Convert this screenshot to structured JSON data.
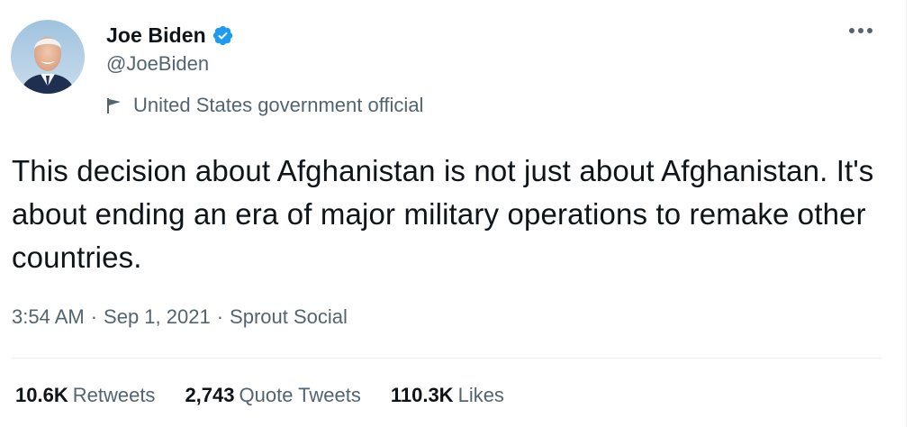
{
  "tweet": {
    "display_name": "Joe Biden",
    "handle": "@JoeBiden",
    "label": "United States government official",
    "text": "This decision about Afghanistan is not just about Afghanistan. It's about ending an era of major military operations to remake other countries.",
    "time": "3:54 AM",
    "date": "Sep 1, 2021",
    "source": "Sprout Social",
    "separator": "·"
  },
  "stats": {
    "retweets_count": "10.6K",
    "retweets_label": "Retweets",
    "quotes_count": "2,743",
    "quotes_label": "Quote Tweets",
    "likes_count": "110.3K",
    "likes_label": "Likes"
  },
  "icons": {
    "verified": "verified-badge-icon",
    "label": "flag-icon",
    "more": "more-options-icon"
  },
  "colors": {
    "text_primary": "#0f1419",
    "text_secondary": "#536471",
    "verified_blue": "#1d9bf0",
    "divider": "#eff3f4"
  }
}
